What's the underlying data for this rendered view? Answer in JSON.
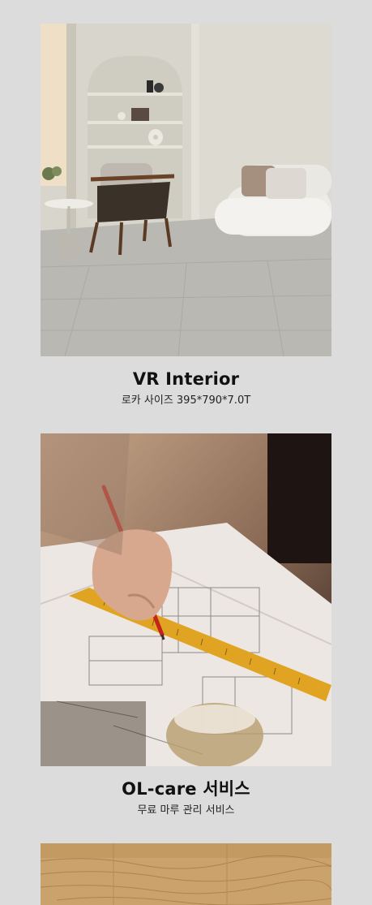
{
  "products": [
    {
      "title": "VR Interior",
      "subtitle": "로카 사이즈 395*790*7.0T",
      "image_alt": "living room interior with grey stone-look tile floor"
    },
    {
      "title": "OL-care 서비스",
      "subtitle": "무료 마루 관리 서비스",
      "image_alt": "hand drawing floor plan with pencil and ruler"
    },
    {
      "image_alt": "light oak wood flooring"
    }
  ]
}
